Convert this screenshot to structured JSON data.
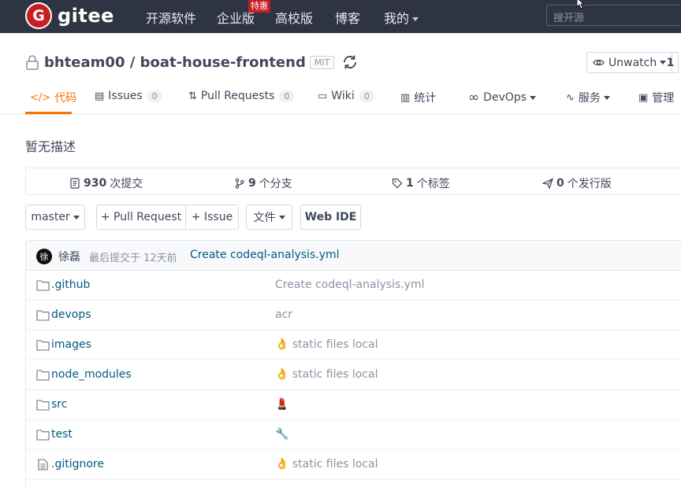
{
  "topnav": {
    "logo_letter": "G",
    "logo_text": "gitee",
    "links": [
      "开源软件",
      "企业版",
      "高校版",
      "博客",
      "我的"
    ],
    "badge": "特惠",
    "search_placeholder": "搜开源"
  },
  "repo": {
    "title": "bhteam00 / boat-house-frontend",
    "license": "MIT",
    "watch_label": "Unwatch",
    "watch_count": "1"
  },
  "tabs": [
    {
      "icon": "</>",
      "label": "代码",
      "count": ""
    },
    {
      "icon": "▤",
      "label": "Issues",
      "count": "0"
    },
    {
      "icon": "⇅",
      "label": "Pull Requests",
      "count": "0"
    },
    {
      "icon": "▭",
      "label": "Wiki",
      "count": "0"
    },
    {
      "icon": "▥",
      "label": "统计",
      "count": ""
    },
    {
      "icon": "∞",
      "label": "DevOps",
      "count": ""
    },
    {
      "icon": "∿",
      "label": "服务",
      "count": ""
    },
    {
      "icon": "▣",
      "label": "管理",
      "count": ""
    }
  ],
  "description": "暂无描述",
  "stats": {
    "commits_num": "930",
    "commits_label": "次提交",
    "branches_num": "9",
    "branches_label": "个分支",
    "tags_num": "1",
    "tags_label": "个标签",
    "releases_num": "0",
    "releases_label": "个发行版"
  },
  "actions": {
    "branch": "master",
    "pull_request": "+ Pull Request",
    "issue": "+ Issue",
    "file": "文件",
    "web_ide": "Web IDE"
  },
  "last_commit": {
    "avatar_char": "徐",
    "author": "徐磊",
    "time": "最后提交于 12天前",
    "message": "Create codeql-analysis.yml"
  },
  "files": [
    {
      "name": ".github",
      "type": "folder",
      "message": "Create codeql-analysis.yml"
    },
    {
      "name": "devops",
      "type": "folder",
      "message": "acr"
    },
    {
      "name": "images",
      "type": "folder",
      "message": "👌 static files local"
    },
    {
      "name": "node_modules",
      "type": "folder",
      "message": "👌 static files local"
    },
    {
      "name": "src",
      "type": "folder",
      "message": "💄"
    },
    {
      "name": "test",
      "type": "folder",
      "message": "🔧"
    },
    {
      "name": ".gitignore",
      "type": "file",
      "message": "👌 static files local"
    }
  ],
  "colors": {
    "nav_bg": "#2e3442",
    "brand_red": "#c71d23",
    "accent_orange": "#fe7300",
    "link_blue": "#005980"
  }
}
